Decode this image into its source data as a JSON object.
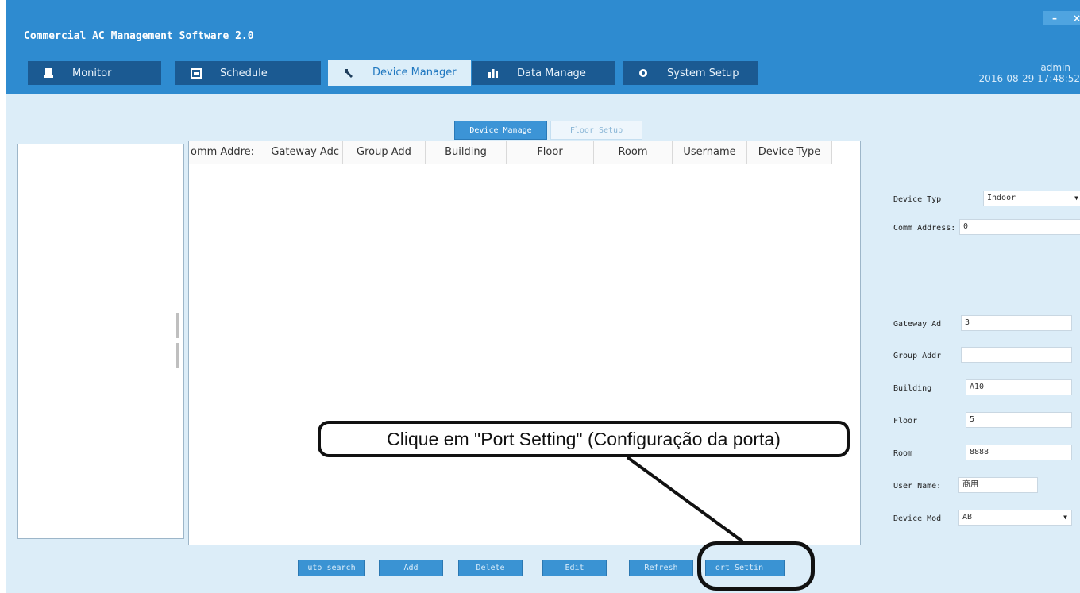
{
  "app": {
    "title": "Commercial AC Management Software 2.0",
    "minimize_label": "–",
    "close_label": "×"
  },
  "nav": {
    "tabs": [
      {
        "label": "Monitor",
        "icon": "monitor-icon",
        "active": false
      },
      {
        "label": "Schedule",
        "icon": "calendar-icon",
        "active": false
      },
      {
        "label": "Device Manager",
        "icon": "wrench-icon",
        "active": true
      },
      {
        "label": "Data Manage",
        "icon": "bar-chart-icon",
        "active": false
      },
      {
        "label": "System Setup",
        "icon": "gear-icon",
        "active": false
      }
    ]
  },
  "user": {
    "name": "admin",
    "datetime": "2016-08-29 17:48:52"
  },
  "subtabs": [
    {
      "label": "Device Manage",
      "active": true
    },
    {
      "label": "Floor Setup",
      "active": false
    }
  ],
  "grid": {
    "columns": [
      "omm Addre:",
      "Gateway Adc",
      "Group Add",
      "Building",
      "Floor",
      "Room",
      "Username",
      "Device Type"
    ],
    "rows": []
  },
  "details": {
    "device_type": {
      "label": "Device Typ",
      "value": "Indoor"
    },
    "comm_address": {
      "label": "Comm Address:",
      "value": "0"
    },
    "gateway_address": {
      "label": "Gateway Ad",
      "value": "3"
    },
    "group_address": {
      "label": "Group Addr",
      "value": ""
    },
    "building": {
      "label": "Building",
      "value": "A10"
    },
    "floor": {
      "label": "Floor",
      "value": "5"
    },
    "room": {
      "label": "Room",
      "value": "8888"
    },
    "user_name": {
      "label": "User Name:",
      "value": "商用"
    },
    "device_model": {
      "label": "Device Mod",
      "value": "AB"
    }
  },
  "actions": {
    "auto_search": "uto search",
    "add": "Add",
    "delete": "Delete",
    "edit": "Edit",
    "refresh": "Refresh",
    "port_setting": "ort Settin"
  },
  "annotation": {
    "callout": "Clique em \"Port Setting\" (Configuração da porta)"
  },
  "colors": {
    "header": "#2e8bd0",
    "tab": "#1b5a92",
    "tab_active": "#dceef9",
    "content_bg": "#dcedf8",
    "button": "#3a93d3"
  }
}
